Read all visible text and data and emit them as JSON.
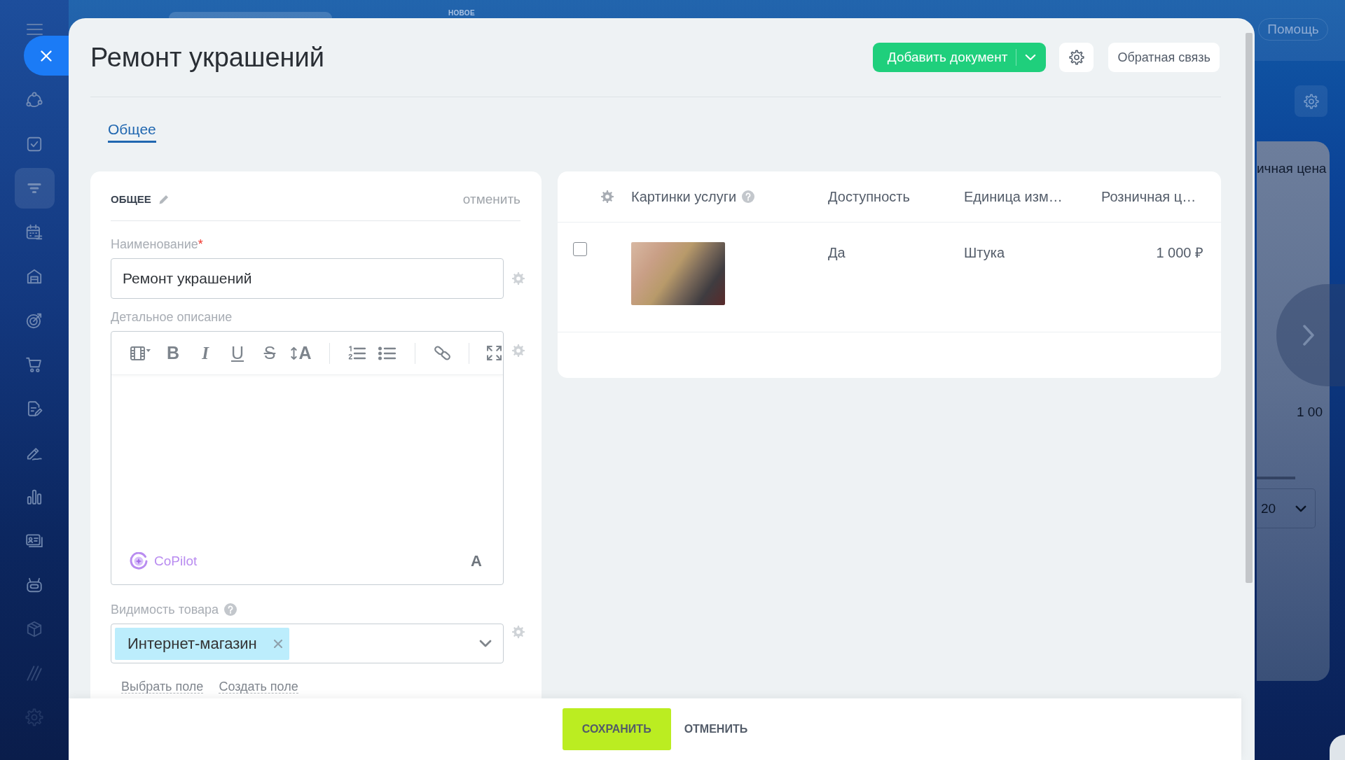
{
  "sidebar": {
    "items": [
      {
        "selected": false
      },
      {
        "selected": false
      },
      {
        "selected": true
      },
      {
        "selected": false
      },
      {
        "selected": false
      },
      {
        "selected": false
      },
      {
        "selected": false
      },
      {
        "selected": false
      },
      {
        "selected": false
      },
      {
        "selected": false
      },
      {
        "selected": false
      },
      {
        "selected": false
      },
      {
        "selected": false
      },
      {
        "selected": false
      },
      {
        "selected": false
      }
    ]
  },
  "background_page": {
    "top_label": "НОВОЕ",
    "help_button": "Помощь",
    "column_header": "ичная цена",
    "cell": "1 00",
    "page_size": "20"
  },
  "modal": {
    "title": "Ремонт украшений",
    "add_document_button": "Добавить документ",
    "feedback_button": "Обратная связь"
  },
  "tabs": [
    {
      "label": "Общее",
      "selected": true
    }
  ],
  "form": {
    "section_title": "ОБЩЕЕ",
    "cancel_link": "отменить",
    "fields": [
      {
        "kind": "text",
        "label": "Наименование",
        "required_mark": "*",
        "value": "Ремонт украшений"
      },
      {
        "kind": "editor",
        "label": "Детальное описание",
        "format_buttons": [
          "B",
          "I",
          "U",
          "S",
          "A"
        ],
        "copilot_button": "CoPilot",
        "text_color_button": "A"
      },
      {
        "kind": "tags",
        "label": "Видимость товара",
        "help": true,
        "tags": [
          "Интернет-магазин"
        ]
      }
    ],
    "links": [
      "Выбрать поле",
      "Создать поле"
    ]
  },
  "table": {
    "columns": [
      {
        "label": "Картинки услуги",
        "help": true
      },
      {
        "label": "Доступность"
      },
      {
        "label": "Единица изм…"
      },
      {
        "label": "Розничная ц…"
      }
    ],
    "rows": [
      {
        "checked": false,
        "cells": [
          "",
          "Да",
          "Штука",
          "1 000 ₽"
        ]
      }
    ]
  },
  "footer": {
    "buttons": [
      {
        "label": "СОХРАНИТЬ",
        "kind": "primary"
      },
      {
        "label": "ОТМЕНИТЬ",
        "kind": "plain"
      }
    ]
  }
}
